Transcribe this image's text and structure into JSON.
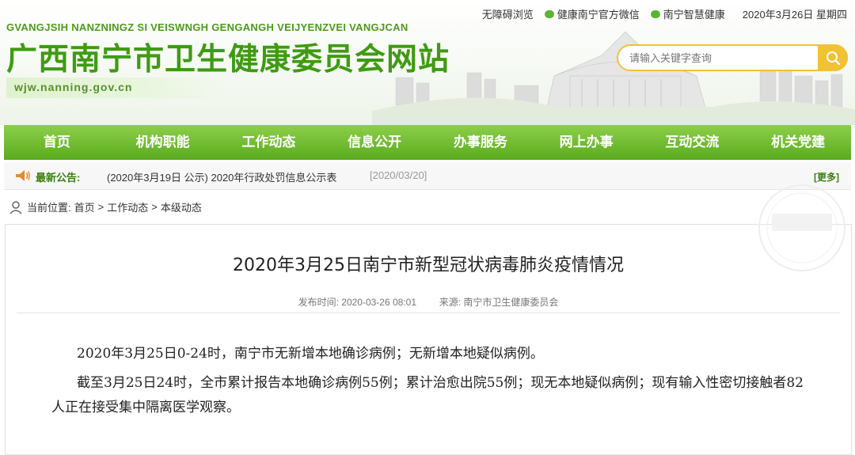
{
  "header": {
    "pinyin": "GVANGJSIH NANZNINGZ SI VEISWNGH GENGANGH VEIJYENZVEI VANGJCAN",
    "site_title": "广西南宁市卫生健康委员会网站",
    "site_url": "wjw.nanning.gov.cn",
    "top_links": {
      "accessibility": "无障碍浏览",
      "wechat_official": "健康南宁官方微信",
      "smart_health": "南宁智慧健康",
      "date": "2020年3月26日 星期四"
    },
    "search": {
      "placeholder": "请输入关键字查询"
    }
  },
  "nav": [
    "首页",
    "机构职能",
    "工作动态",
    "信息公开",
    "办事服务",
    "网上办事",
    "互动交流",
    "机关党建"
  ],
  "notice": {
    "label": "最新公告:",
    "text": "(2020年3月19日 公示) 2020年行政处罚信息公示表",
    "date": "[2020/03/20]",
    "more": "[更多]"
  },
  "breadcrumb": {
    "prefix": "当前位置:",
    "items": [
      "首页",
      "工作动态",
      "本级动态"
    ],
    "separator": ">"
  },
  "article": {
    "title": "2020年3月25日南宁市新型冠状病毒肺炎疫情情况",
    "publish_label": "发布时间:",
    "publish_time": "2020-03-26 08:01",
    "source_label": "来源:",
    "source": "南宁市卫生健康委员会",
    "paragraphs": [
      "2020年3月25日0-24时，南宁市无新增本地确诊病例；无新增本地疑似病例。",
      "截至3月25日24时，全市累计报告本地确诊病例55例；累计治愈出院55例；现无本地疑似病例；现有输入性密切接触者82人正在接受集中隔离医学观察。"
    ]
  },
  "colors": {
    "brand_green": "#5aab1e",
    "title_green": "#3e9b12",
    "search_accent": "#f1c232"
  }
}
